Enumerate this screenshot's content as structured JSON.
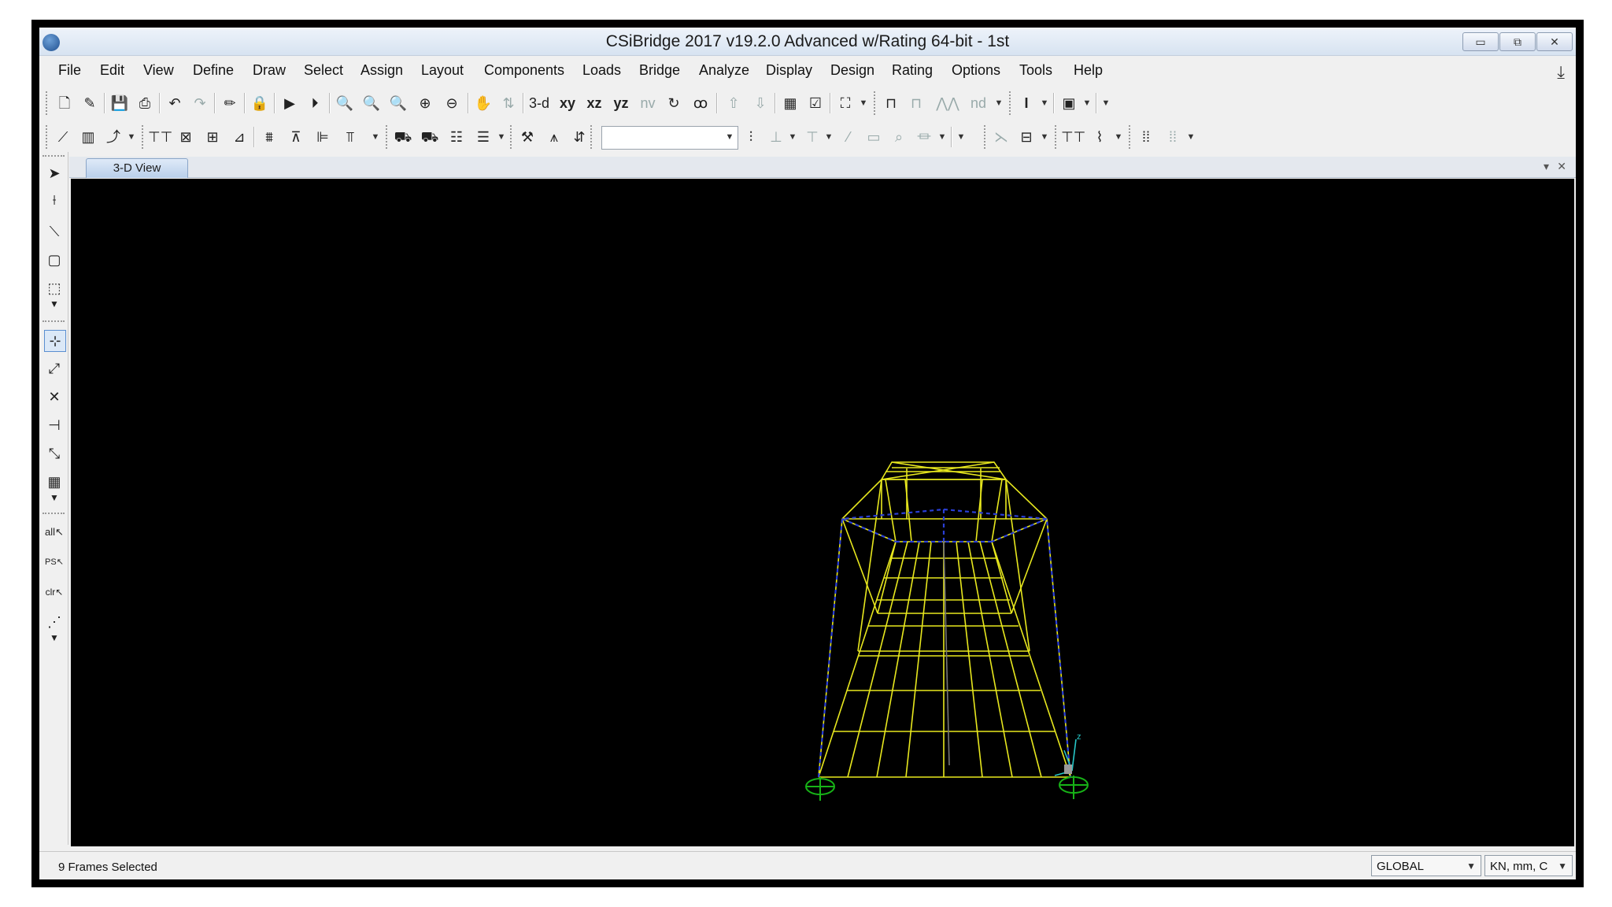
{
  "window": {
    "title": "CSiBridge 2017 v19.2.0 Advanced w/Rating 64-bit - 1st",
    "controls": {
      "minimize": "▭",
      "restore": "⧉",
      "close": "✕"
    }
  },
  "menu": [
    "File",
    "Edit",
    "View",
    "Define",
    "Draw",
    "Select",
    "Assign",
    "Layout",
    "Components",
    "Loads",
    "Bridge",
    "Analyze",
    "Display",
    "Design",
    "Rating",
    "Options",
    "Tools",
    "Help"
  ],
  "toolbar_text": {
    "view_3d": "3-d",
    "view_xy": "xy",
    "view_xz": "xz",
    "view_yz": "yz",
    "view_nv": "nv",
    "nd": "nd"
  },
  "left_tool_text": {
    "select_all": "all",
    "select_prev": "PS",
    "clear_selection": "clr"
  },
  "tabs": {
    "active": "3-D View"
  },
  "status": {
    "message": "9 Frames Selected",
    "coord_system": "GLOBAL",
    "units": "KN, mm, C"
  },
  "colors": {
    "model_lines": "#e8e81e",
    "restraints": "#17b317",
    "frame_selected": "#2a3fd6",
    "axes": "#27c7c7",
    "background": "#000000"
  }
}
